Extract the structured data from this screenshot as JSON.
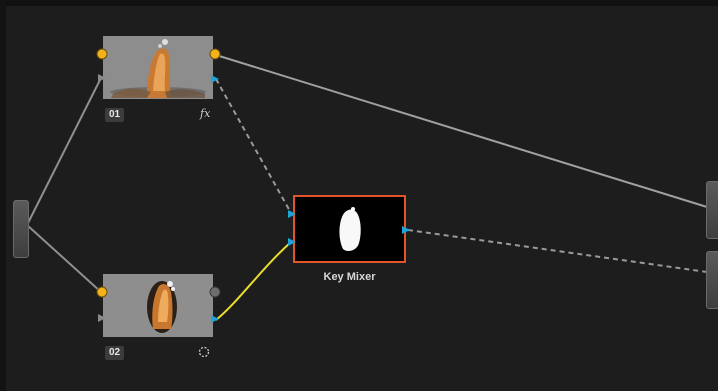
{
  "nodes": [
    {
      "id": "node-01",
      "label": "01",
      "effect_icon": "fx-icon"
    },
    {
      "id": "node-02",
      "label": "02",
      "effect_icon": "circle-dashed-icon"
    },
    {
      "id": "key-mixer",
      "label": "Key Mixer"
    }
  ],
  "labels": {
    "node01": "01",
    "node02": "02",
    "fx": "fx",
    "key_mixer": "Key Mixer"
  },
  "colors": {
    "background": "#1d1d1d",
    "rgb_port": "#f2b21b",
    "key_port": "#1fa3d8",
    "selection_outline": "#e0552a",
    "active_key_wire": "#e8dc2c",
    "wire": "#9a9a9a"
  }
}
